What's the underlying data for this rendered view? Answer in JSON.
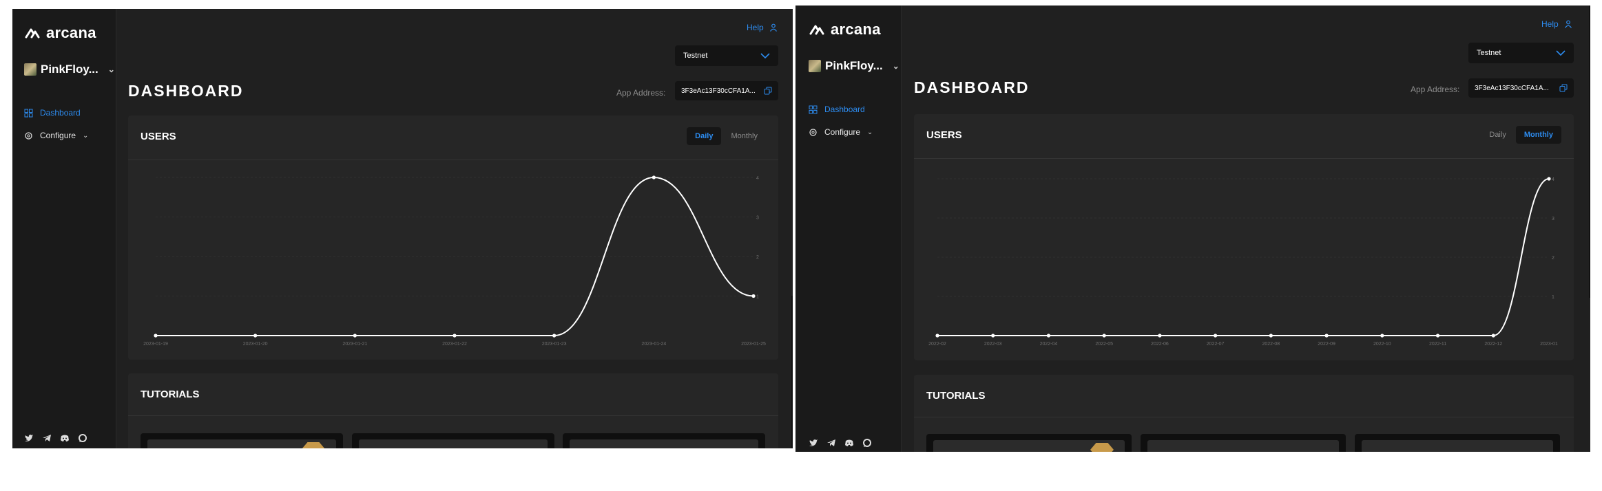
{
  "logo_text": "arcana",
  "app_name": "PinkFloy...",
  "nav": {
    "dashboard": "Dashboard",
    "configure": "Configure"
  },
  "help": "Help",
  "network": "Testnet",
  "page_title": "DASHBOARD",
  "app_address_label": "App Address:",
  "app_address": "3F3eAc13F30cCFA1A...",
  "users_title": "USERS",
  "toggle": {
    "daily": "Daily",
    "monthly": "Monthly"
  },
  "tutorials_title": "TUTORIALS",
  "icons": [
    "logo-icon",
    "dashboard-icon",
    "gear-icon",
    "chevron-down-icon",
    "twitter-icon",
    "telegram-icon",
    "discord-icon",
    "chat-icon",
    "user-icon",
    "copy-icon"
  ],
  "colors": {
    "accent": "#2d8cf0",
    "bg": "#202020",
    "sidebar": "#1a1a1a",
    "card": "#262626"
  },
  "chart_data": [
    {
      "type": "line",
      "x": [
        "2023-01-19",
        "2023-01-20",
        "2023-01-21",
        "2023-01-22",
        "2023-01-23",
        "2023-01-24",
        "2023-01-25"
      ],
      "values": [
        0,
        0,
        0,
        0,
        0,
        4,
        1
      ],
      "ylim": [
        0,
        4
      ],
      "yticks": [
        "1",
        "2",
        "3",
        "4"
      ],
      "grid": true
    },
    {
      "type": "line",
      "x": [
        "2022-02",
        "2022-03",
        "2022-04",
        "2022-05",
        "2022-06",
        "2022-07",
        "2022-08",
        "2022-09",
        "2022-10",
        "2022-11",
        "2022-12",
        "2023-01"
      ],
      "values": [
        0,
        0,
        0,
        0,
        0,
        0,
        0,
        0,
        0,
        0,
        0,
        4
      ],
      "ylim": [
        0,
        4
      ],
      "yticks": [
        "1",
        "2",
        "3",
        "4"
      ],
      "grid": true
    }
  ]
}
